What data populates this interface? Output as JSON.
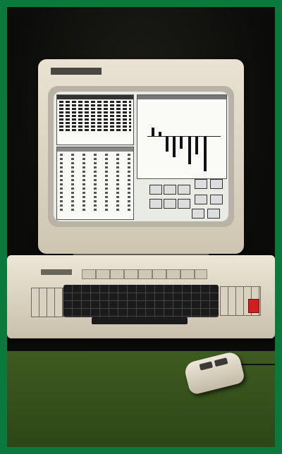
{
  "image": {
    "subject": "",
    "frame_color": "#0a7a3c",
    "accent_key_color": "#d21e1e"
  },
  "icons": [
    "monitor-icon",
    "keyboard-icon",
    "mouse-icon"
  ]
}
